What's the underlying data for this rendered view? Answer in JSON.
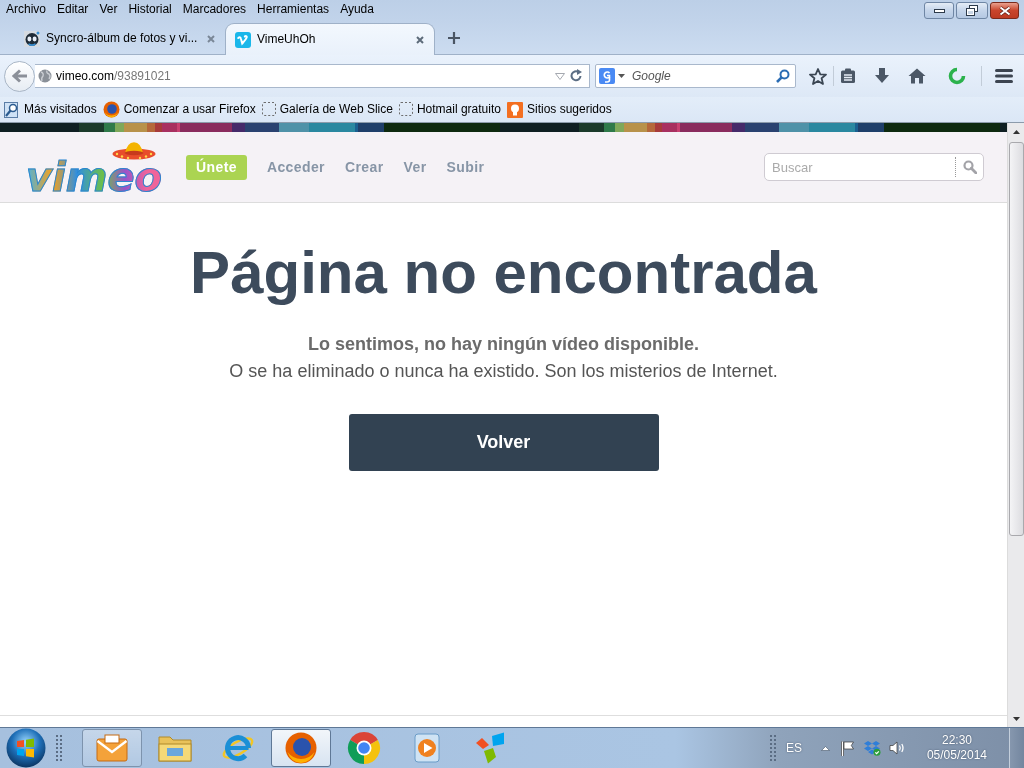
{
  "menu": [
    "Archivo",
    "Editar",
    "Ver",
    "Historial",
    "Marcadores",
    "Herramientas",
    "Ayuda"
  ],
  "tabs": [
    {
      "kind": "photo",
      "title": "Syncro-álbum de fotos y vi...",
      "selected": false
    },
    {
      "kind": "video",
      "title": "VimeUhOh",
      "selected": true
    }
  ],
  "toolbar": {
    "url_host": "vimeo.com",
    "url_path": "/93891021",
    "search_placeholder": "Google"
  },
  "bookmarks": [
    {
      "kind": "smart",
      "label": "Más visitados"
    },
    {
      "kind": "browser",
      "label": "Comenzar a usar Firefox"
    },
    {
      "kind": "slice",
      "label": "Galería de Web Slice"
    },
    {
      "kind": "slice",
      "label": "Hotmail gratuito"
    },
    {
      "kind": "suggested",
      "label": "Sitios sugeridos"
    }
  ],
  "page": {
    "logo": "vimeo",
    "nav": [
      {
        "kind": "button",
        "label": "Únete"
      },
      {
        "kind": "link",
        "label": "Acceder"
      },
      {
        "kind": "link",
        "label": "Crear"
      },
      {
        "kind": "link",
        "label": "Ver"
      },
      {
        "kind": "link",
        "label": "Subir"
      }
    ],
    "search_placeholder": "Buscar",
    "heading": "Página no encontrada",
    "subheading": "Lo sentimos, no hay ningún vídeo disponible.",
    "message": "O se ha eliminado o nunca ha existido. Son los misterios de Internet.",
    "button": "Volver"
  },
  "taskbar": {
    "apps": [
      {
        "kind": "mail",
        "running": true,
        "active": false
      },
      {
        "kind": "folder",
        "running": false,
        "active": false
      },
      {
        "kind": "ebrowser",
        "running": false,
        "active": false
      },
      {
        "kind": "foxbrowser",
        "running": true,
        "active": true
      },
      {
        "kind": "ringbrowser",
        "running": false,
        "active": false
      },
      {
        "kind": "player",
        "running": false,
        "active": false
      },
      {
        "kind": "pinwheel",
        "running": false,
        "active": false
      }
    ],
    "language": "ES",
    "time": "22:30",
    "date": "05/05/2014"
  }
}
